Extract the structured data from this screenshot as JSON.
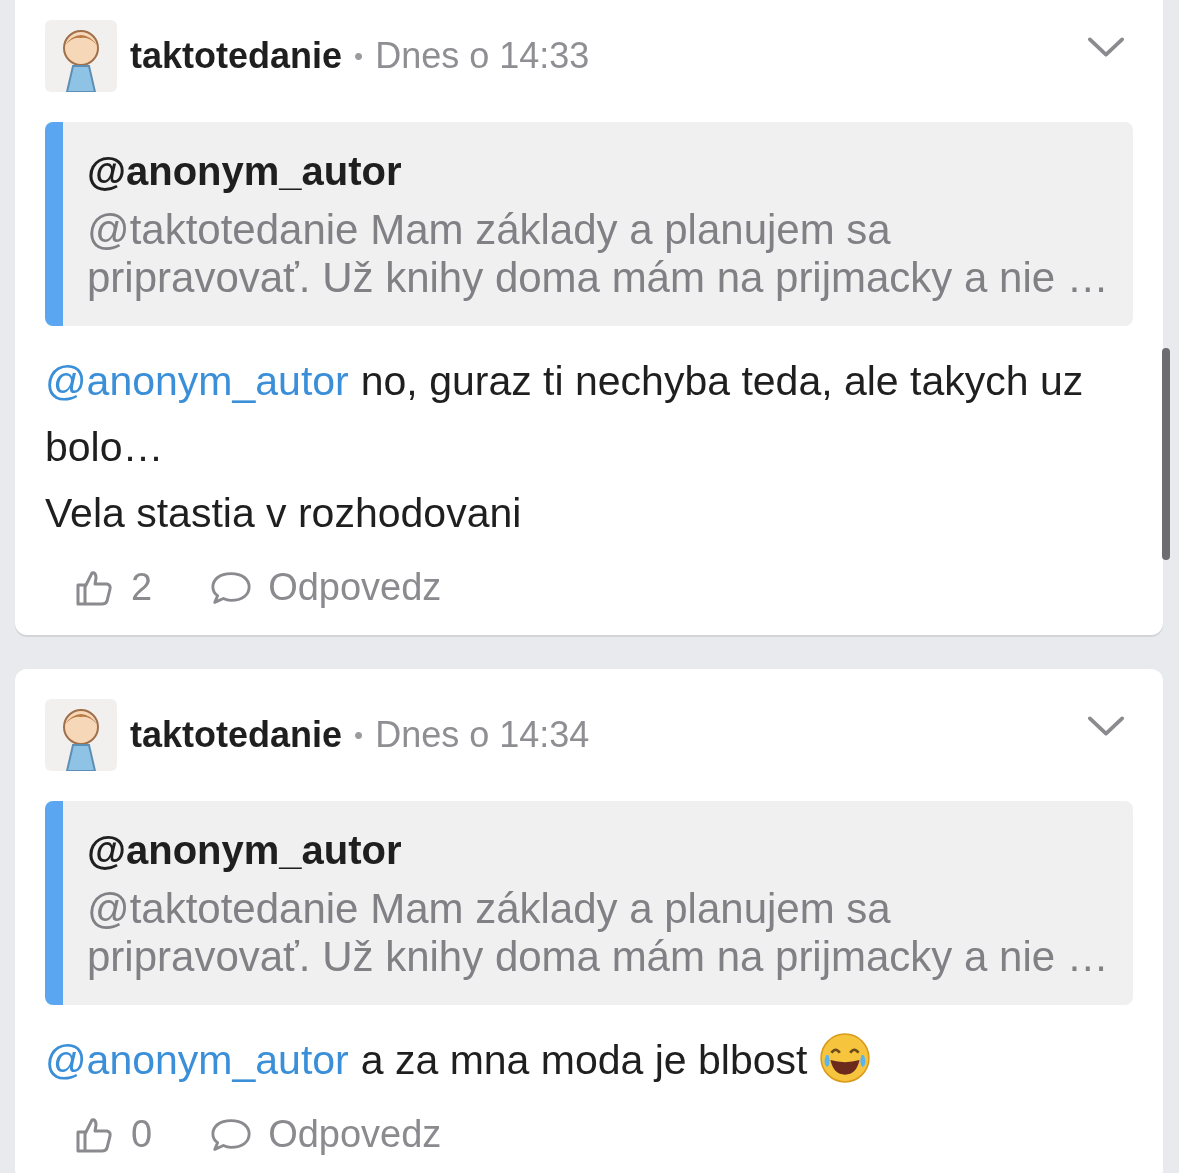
{
  "posts": [
    {
      "author": "taktotedanie",
      "separator": "•",
      "time": "Dnes o 14:33",
      "quote": {
        "author": "@anonym_autor",
        "text": "@taktotedanie Mam základy a planujem sa pripravovať. Už knihy doma mám na prijmacky a nie …"
      },
      "paragraphs": [
        {
          "mention": "@anonym_autor",
          "text": "no, guraz ti nechyba teda, ale takych uz bolo…"
        },
        {
          "text": "Vela stastia v rozhodovani"
        }
      ],
      "likes": "2",
      "reply_label": "Odpovedz"
    },
    {
      "author": "taktotedanie",
      "separator": "•",
      "time": "Dnes o 14:34",
      "quote": {
        "author": "@anonym_autor",
        "text": "@taktotedanie Mam základy a planujem sa pripravovať. Už knihy doma mám na prijmacky a nie …"
      },
      "paragraphs": [
        {
          "mention": "@anonym_autor",
          "text": "a za mna moda je blbost",
          "laughing_emoji": true
        }
      ],
      "likes": "0",
      "reply_label": "Odpovedz"
    }
  ]
}
